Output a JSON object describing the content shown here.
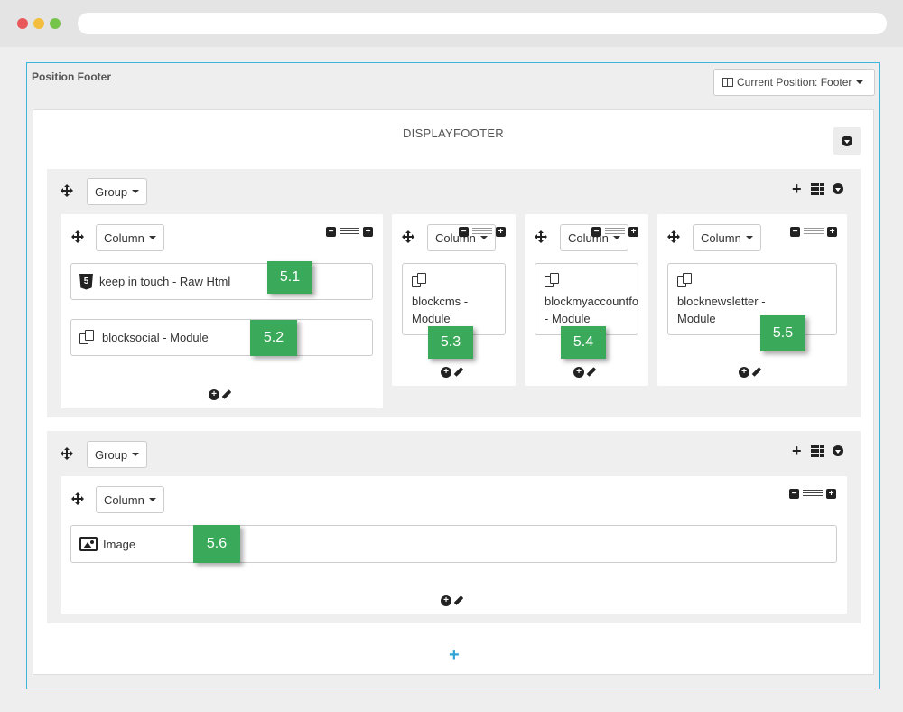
{
  "panel": {
    "title": "Position Footer",
    "position_button": "Current Position: Footer"
  },
  "hook": {
    "title": "DISPLAYFOOTER"
  },
  "groups": [
    {
      "label": "Group",
      "columns": [
        {
          "label": "Column",
          "modules": [
            {
              "text": "keep in touch - Raw Html",
              "icon": "html5-icon",
              "badge": "5.1"
            },
            {
              "text": "blocksocial - Module",
              "icon": "copy-icon",
              "badge": "5.2"
            }
          ]
        },
        {
          "label": "Column",
          "modules": [
            {
              "line1": "blockcms -",
              "line2": "Module",
              "icon": "copy-icon",
              "badge": "5.3"
            }
          ]
        },
        {
          "label": "Column",
          "modules": [
            {
              "line1": "blockmyaccountfooter",
              "line2": "- Module",
              "icon": "copy-icon",
              "badge": "5.4"
            }
          ]
        },
        {
          "label": "Column",
          "modules": [
            {
              "line1": "blocknewsletter -",
              "line2": "Module",
              "icon": "copy-icon",
              "badge": "5.5"
            }
          ]
        }
      ]
    },
    {
      "label": "Group",
      "columns": [
        {
          "label": "Column",
          "modules": [
            {
              "text": "Image",
              "icon": "image-icon",
              "badge": "5.6"
            }
          ]
        }
      ]
    }
  ],
  "icons": {
    "add": "+",
    "accent_color": "#3aaa5a",
    "border_accent": "#3fb5da"
  }
}
